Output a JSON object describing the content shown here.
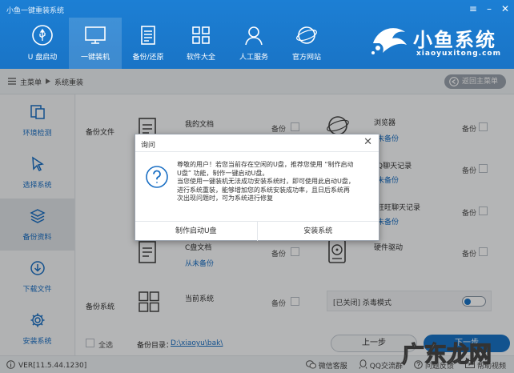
{
  "window": {
    "title": "小鱼一键重装系统",
    "controls": [
      "≡",
      "–",
      "✕"
    ]
  },
  "nav": {
    "items": [
      {
        "label": "U 盘启动",
        "icon": "usb-icon",
        "active": false
      },
      {
        "label": "一键装机",
        "icon": "monitor-icon",
        "active": true
      },
      {
        "label": "备份/还原",
        "icon": "backup-icon",
        "active": false
      },
      {
        "label": "软件大全",
        "icon": "grid-icon",
        "active": false
      },
      {
        "label": "人工服务",
        "icon": "person-icon",
        "active": false
      },
      {
        "label": "官方网站",
        "icon": "browser-icon",
        "active": false
      }
    ]
  },
  "brand": {
    "name": "小鱼系统",
    "domain": "xiaoyuxitong.com"
  },
  "breadcrumb": {
    "home": "主菜单",
    "current": "系统重装"
  },
  "back_button": "返回主菜单",
  "sidebar": {
    "items": [
      {
        "label": "环境检测",
        "icon": "detect-icon",
        "active": false
      },
      {
        "label": "选择系统",
        "icon": "cursor-icon",
        "active": false
      },
      {
        "label": "备份资料",
        "icon": "layers-icon",
        "active": true
      },
      {
        "label": "下载文件",
        "icon": "download-icon",
        "active": false
      },
      {
        "label": "安装系统",
        "icon": "gear-icon",
        "active": false
      }
    ]
  },
  "content": {
    "backup_files_label": "备份文件",
    "backup_system_label": "备份系统",
    "items": {
      "my_docs": {
        "name": "我的文档",
        "checkbox": "备份"
      },
      "browser": {
        "name": "浏览器",
        "sub": "未备份",
        "checkbox": "备份"
      },
      "qq": {
        "name": "Q聊天记录",
        "sub": "未备份",
        "checkbox": "备份"
      },
      "wangwang": {
        "name": "旺旺聊天记录",
        "sub": "未备份",
        "checkbox": "备份"
      },
      "c_docs": {
        "name": "C盘文档",
        "sub": "从未备份",
        "checkbox": "备份"
      },
      "drivers": {
        "name": "硬件驱动",
        "checkbox": "备份"
      },
      "current_system": {
        "name": "当前系统",
        "checkbox": "备份"
      }
    },
    "kill_mode": {
      "text": "[已关闭] 杀毒模式"
    },
    "select_all": "全选",
    "backup_dir_label": "备份目录：",
    "backup_dir_value": "D:\\xiaoyu\\bak\\",
    "prev_button": "上一步",
    "next_button": "下一步"
  },
  "statusbar": {
    "version": "VER[11.5.44.1230]",
    "links": [
      {
        "label": "微信客服",
        "icon": "wechat-icon"
      },
      {
        "label": "QQ交流群",
        "icon": "qq-icon"
      },
      {
        "label": "问题反馈",
        "icon": "feedback-icon"
      },
      {
        "label": "帮助视频",
        "icon": "video-icon"
      }
    ]
  },
  "dialog": {
    "title": "询问",
    "lines": [
      "尊敬的用户！若您当前存在空闲的U盘，推荐您使用 “制作启动",
      "U盘” 功能，制作一键启动U盘。",
      "当您使用一键装机无法成功安装系统时，即可使用此启动U盘，",
      "进行系统重装，能够增加您的系统安装成功率，且日后系统再",
      "次出现问题时，可为系统进行修复"
    ],
    "btn_make_usb": "制作启动U盘",
    "btn_install": "安装系统"
  },
  "watermark": "广东龙网",
  "colors": {
    "header_blue": "#1a74c6",
    "accent_blue": "#1a6fc4",
    "button_grey": "#9aa3ad"
  }
}
